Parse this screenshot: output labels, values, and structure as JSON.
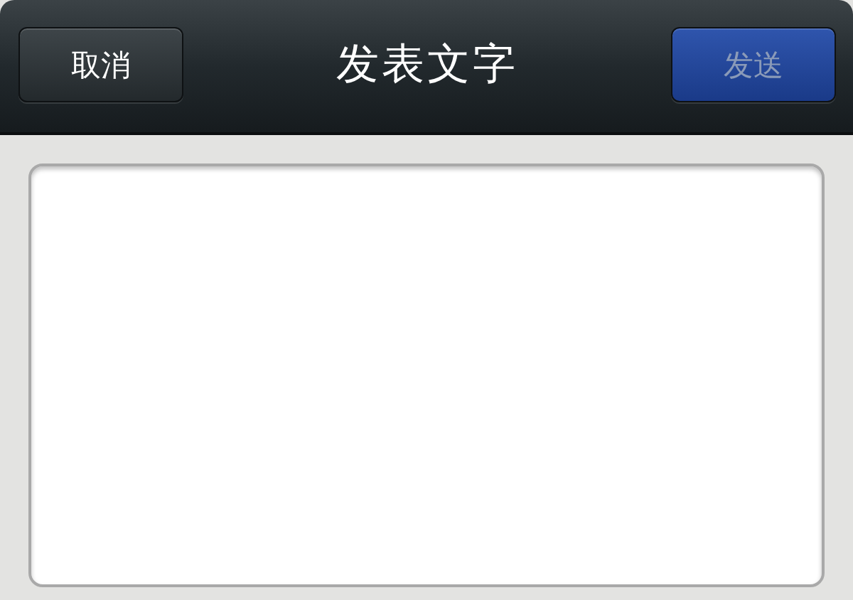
{
  "nav_bar": {
    "title": "发表文字",
    "left_button": {
      "label": "取消",
      "disabled": false
    },
    "right_button": {
      "label": "发送",
      "disabled": true
    }
  }
}
